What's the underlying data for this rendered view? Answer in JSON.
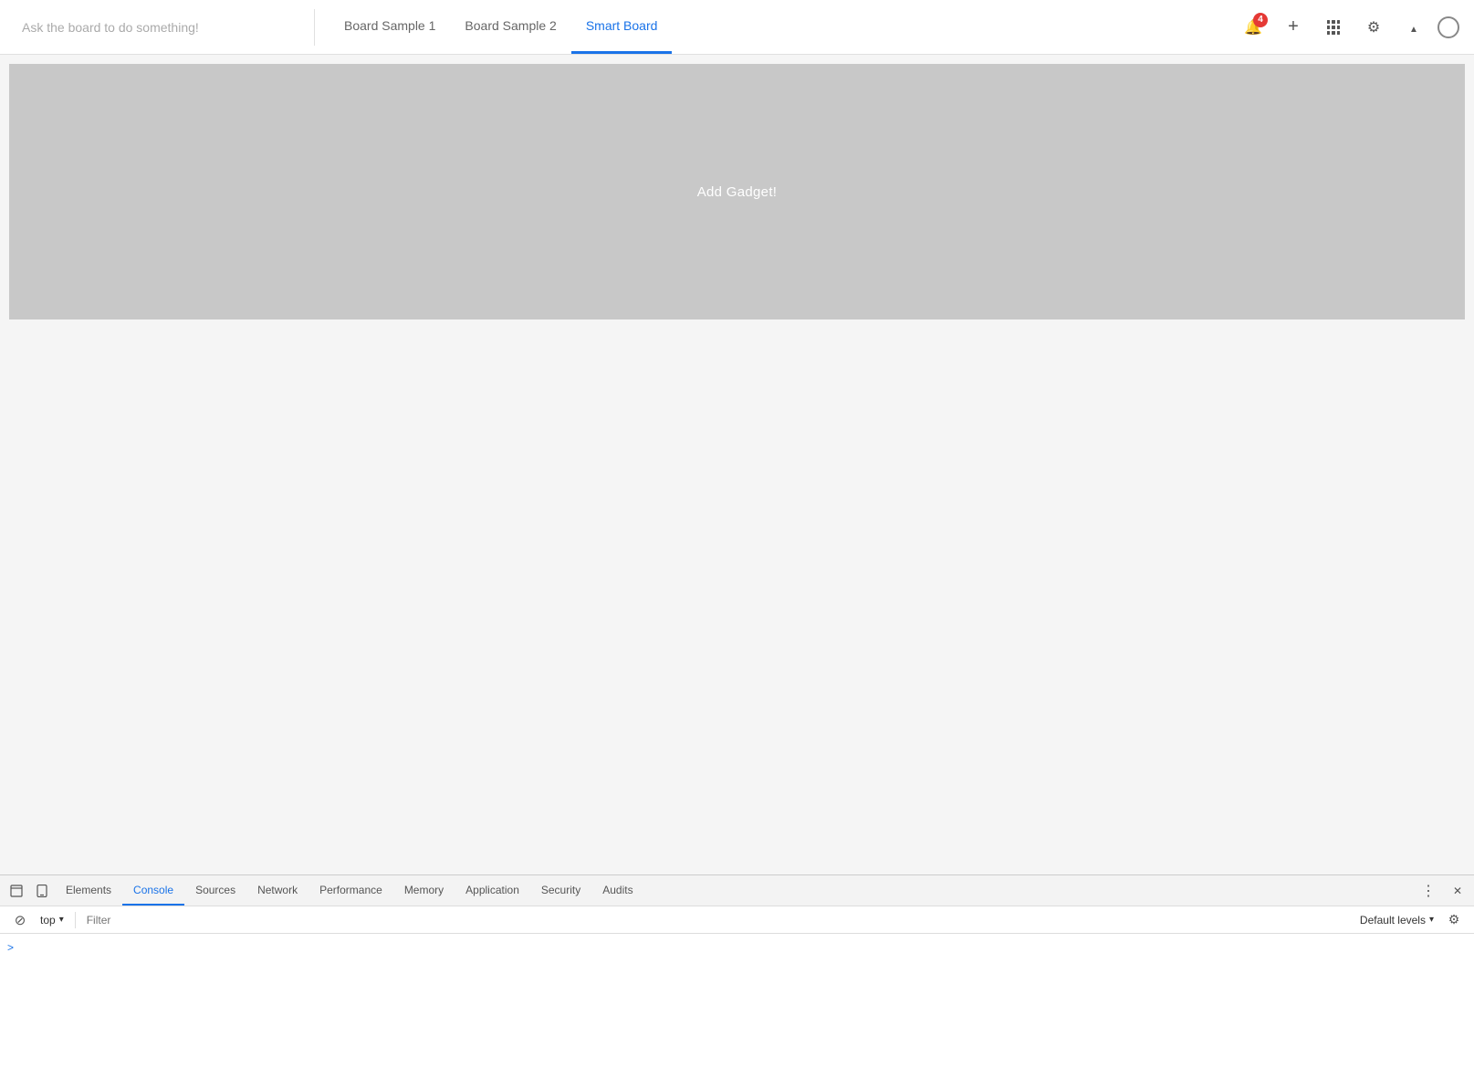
{
  "header": {
    "ask_placeholder": "Ask the board to do something!",
    "tabs": [
      {
        "id": "tab-board-sample-1",
        "label": "Board Sample 1",
        "active": false
      },
      {
        "id": "tab-board-sample-2",
        "label": "Board Sample 2",
        "active": false
      },
      {
        "id": "tab-smart-board",
        "label": "Smart Board",
        "active": true
      }
    ],
    "notification_count": "4",
    "add_label": "+",
    "grid_label": "⋮⋮",
    "settings_label": "⚙",
    "collapse_label": "▲"
  },
  "main": {
    "gadget_label": "Add Gadget!"
  },
  "devtools": {
    "tabs": [
      {
        "id": "elements",
        "label": "Elements",
        "active": false
      },
      {
        "id": "console",
        "label": "Console",
        "active": true
      },
      {
        "id": "sources",
        "label": "Sources",
        "active": false
      },
      {
        "id": "network",
        "label": "Network",
        "active": false
      },
      {
        "id": "performance",
        "label": "Performance",
        "active": false
      },
      {
        "id": "memory",
        "label": "Memory",
        "active": false
      },
      {
        "id": "application",
        "label": "Application",
        "active": false
      },
      {
        "id": "security",
        "label": "Security",
        "active": false
      },
      {
        "id": "audits",
        "label": "Audits",
        "active": false
      }
    ],
    "toolbar": {
      "context_value": "top",
      "filter_placeholder": "Filter",
      "levels_label": "Default levels",
      "levels_arrow": "▾"
    },
    "console_prompt": ">"
  }
}
